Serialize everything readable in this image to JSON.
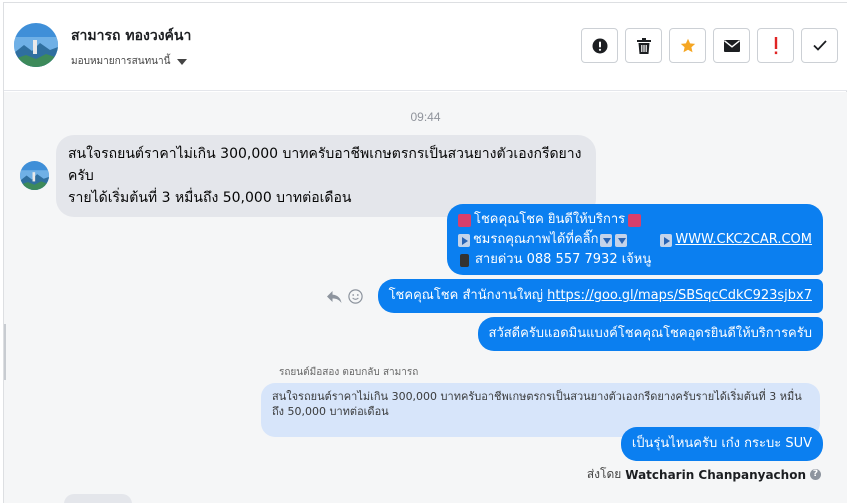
{
  "header": {
    "contact_name": "สามารถ ทองวงค์นา",
    "assign_label": "มอบหมายการสนทนานี้",
    "tools": [
      {
        "icon": "alert-circle-icon"
      },
      {
        "icon": "trash-icon"
      },
      {
        "icon": "star-icon",
        "color": "#f5a623"
      },
      {
        "icon": "envelope-icon"
      },
      {
        "icon": "exclamation-icon",
        "color": "#e02424"
      },
      {
        "icon": "checkmark-icon"
      }
    ]
  },
  "conversation": {
    "timestamp": "09:44",
    "incoming": {
      "line1": "สนใจรถยนต์ราคาไม่เกิน 300,000 บาทครับอาชีพเกษตรกรเป็นสวนยางตัวเองกรีดยางครับ",
      "line2": "รายได้เริ่มต้นที่ 3 หมื่นถึง 50,000 บาทต่อเดือน"
    },
    "outgoing_card": {
      "line1": "โชคคุณโชค ยินดีให้บริการ",
      "line2": "ชมรถคุณภาพได้ที่คลิ๊ก",
      "link1": "WWW.CKC2CAR.COM",
      "line3": "สายด่วน 088 557 7932 เจ้หนู"
    },
    "outgoing_office": {
      "text": "โชคคุณโชค สำนักงานใหญ่ ",
      "link": "https://goo.gl/maps/SBSqcCdkC923sjbx7"
    },
    "outgoing_greeting": "สวัสดีครับแอดมินแบงค์โชคคุณโชคอุดรยินดีให้บริการครับ",
    "reply_note": "รถยนต์มือสอง ตอบกลับ สามารถ",
    "quoted_text": "สนใจรถยนต์ราคาไม่เกิน 300,000 บาทครับอาชีพเกษตรกรเป็นสวนยางตัวเองกรีดยางครับรายได้เริ่มต้นที่ 3 หมื่นถึง 50,000 บาทต่อเดือน",
    "reply_text": "เป็นรุ่นไหนครับ เก๋ง กระบะ SUV",
    "sent_by_label": "ส่งโดย",
    "sent_by_name": "Watcharin Chanpanyachon"
  },
  "colors": {
    "accent": "#0b7ff0",
    "incoming_bubble": "#e4e6eb",
    "quoted_bubble": "#d7e5fa"
  }
}
